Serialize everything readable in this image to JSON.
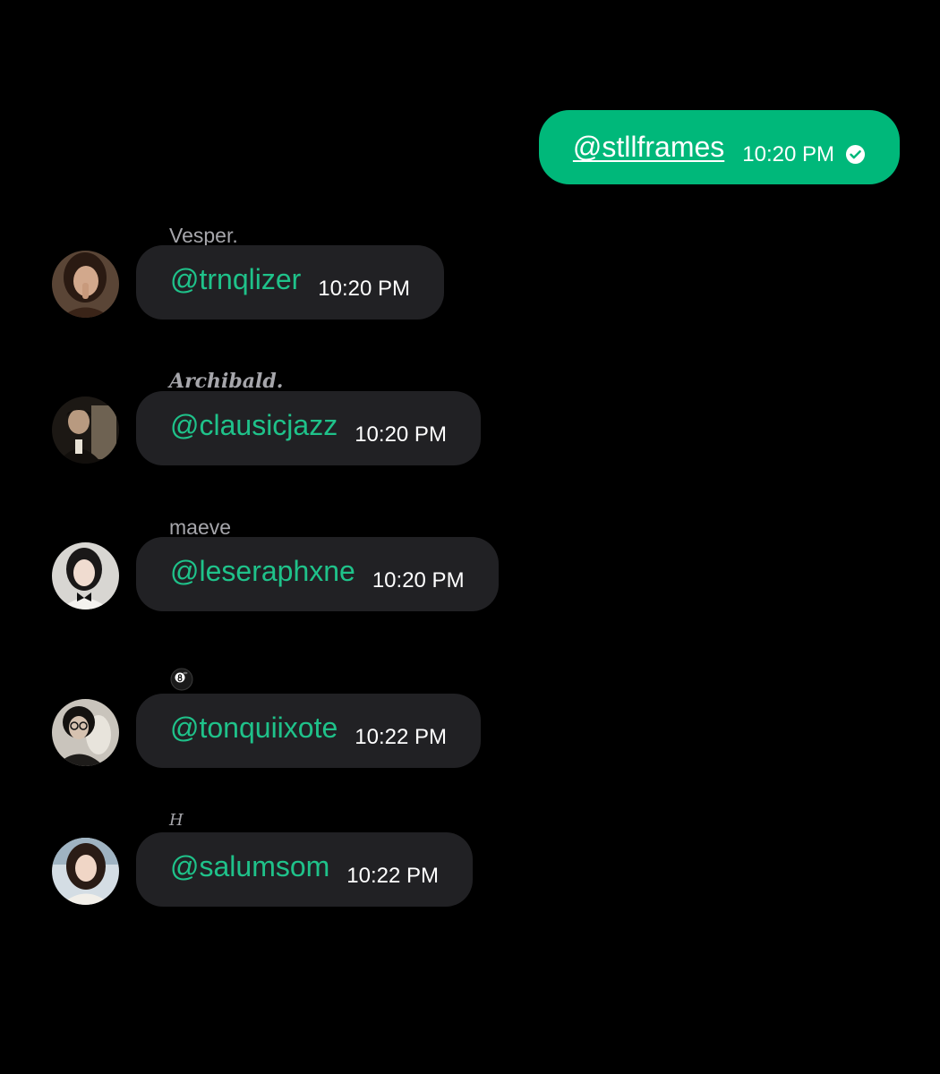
{
  "outgoing": {
    "mention": "@stllframes",
    "time": "10:20 PM",
    "status_icon": "check-circle-icon"
  },
  "messages": [
    {
      "sender": "Vesper.",
      "mention": "@trnqlizer",
      "time": "10:20 PM"
    },
    {
      "sender": "Archibald.",
      "mention": "@clausicjazz",
      "time": "10:20 PM"
    },
    {
      "sender": "maeve",
      "mention": "@leseraphxne",
      "time": "10:20 PM"
    },
    {
      "sender_icon": "eight-ball-icon",
      "mention": "@tonquiixote",
      "time": "10:22 PM"
    },
    {
      "sender": "H",
      "mention": "@salumsom",
      "time": "10:22 PM"
    }
  ],
  "colors": {
    "background": "#000000",
    "outgoing_bubble": "#00b87a",
    "incoming_bubble": "#212124",
    "mention": "#1fc28a",
    "sender": "#a6a6ab"
  }
}
